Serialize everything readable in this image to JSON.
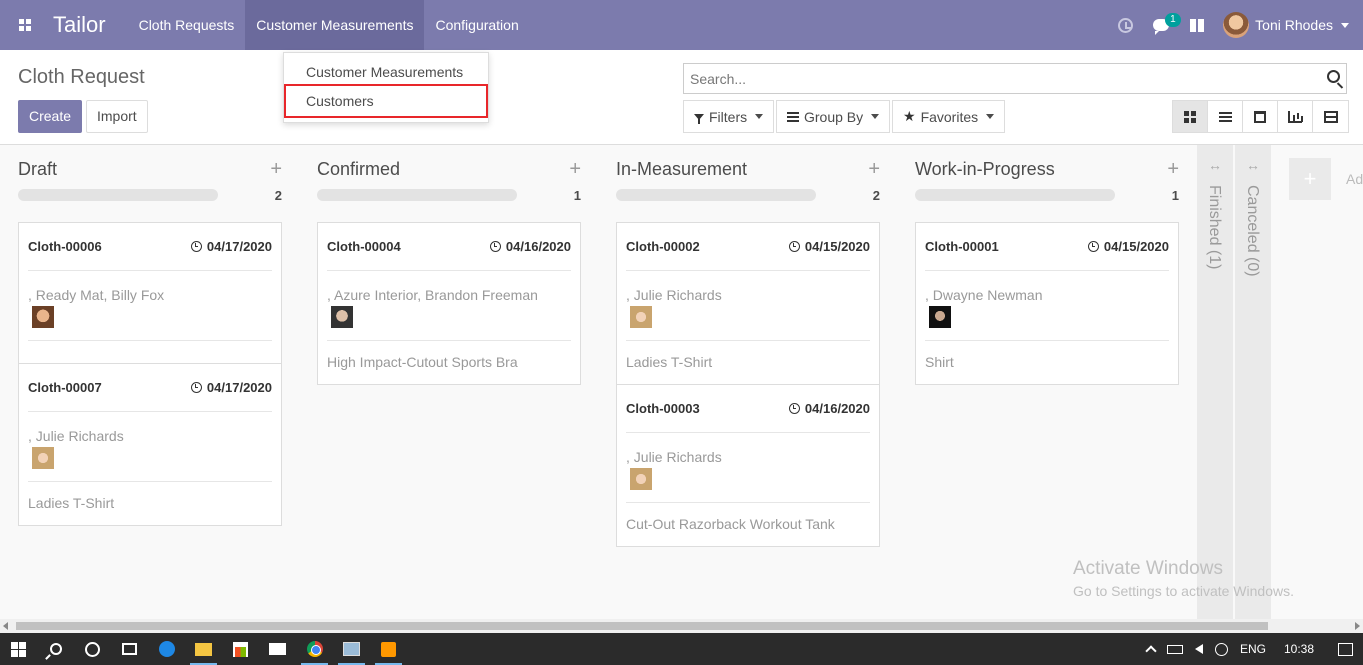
{
  "navbar": {
    "brand": "Tailor",
    "menus": [
      "Cloth Requests",
      "Customer Measurements",
      "Configuration"
    ],
    "chat_badge": "1",
    "user_name": "Toni Rhodes"
  },
  "dropdown": {
    "items": [
      "Customer Measurements",
      "Customers"
    ]
  },
  "control_panel": {
    "title": "Cloth Request",
    "create_label": "Create",
    "import_label": "Import",
    "search_placeholder": "Search...",
    "filters_label": "Filters",
    "group_by_label": "Group By",
    "favorites_label": "Favorites"
  },
  "columns": [
    {
      "title": "Draft",
      "count": "2",
      "cards": [
        {
          "ref": "Cloth-00006",
          "date": "04/17/2020",
          "customer": ", Ready Mat, Billy Fox",
          "product": ""
        },
        {
          "ref": "Cloth-00007",
          "date": "04/17/2020",
          "customer": ", Julie Richards",
          "product": "Ladies T-Shirt"
        }
      ]
    },
    {
      "title": "Confirmed",
      "count": "1",
      "cards": [
        {
          "ref": "Cloth-00004",
          "date": "04/16/2020",
          "customer": ", Azure Interior, Brandon Freeman",
          "product": "High Impact-Cutout Sports Bra"
        }
      ]
    },
    {
      "title": "In-Measurement",
      "count": "2",
      "cards": [
        {
          "ref": "Cloth-00002",
          "date": "04/15/2020",
          "customer": ", Julie Richards",
          "product": "Ladies T-Shirt"
        },
        {
          "ref": "Cloth-00003",
          "date": "04/16/2020",
          "customer": ", Julie Richards",
          "product": "Cut-Out Razorback Workout Tank"
        }
      ]
    },
    {
      "title": "Work-in-Progress",
      "count": "1",
      "cards": [
        {
          "ref": "Cloth-00001",
          "date": "04/15/2020",
          "customer": ", Dwayne Newman",
          "product": "Shirt"
        }
      ]
    }
  ],
  "folded_columns": [
    "Finished (1)",
    "Canceled (0)"
  ],
  "add_column_label": "Ad",
  "watermark": {
    "title": "Activate Windows",
    "subtitle": "Go to Settings to activate Windows."
  },
  "taskbar": {
    "language": "ENG",
    "time": "10:38"
  }
}
